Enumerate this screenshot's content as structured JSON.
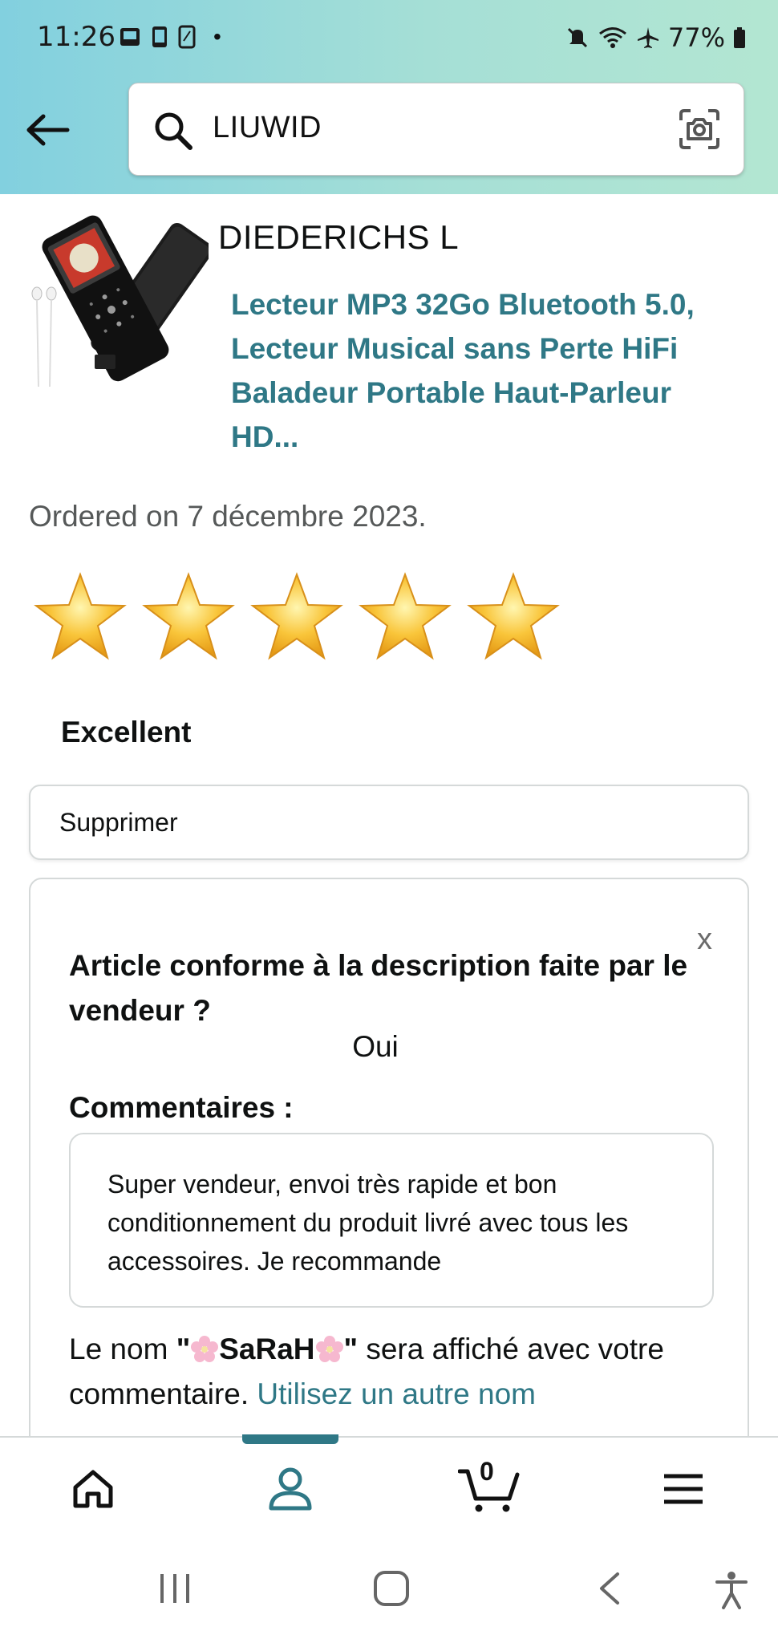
{
  "status_bar": {
    "time": "11:26",
    "dot": "•",
    "battery": "77%"
  },
  "search": {
    "value": "LIUWID"
  },
  "product": {
    "seller": "DIEDERICHS L",
    "title": "Lecteur MP3 32Go Bluetooth 5.0, Lecteur Musical sans Perte HiFi Baladeur Portable Haut-Parleur HD...",
    "ordered_on": "Ordered on 7 décembre 2023."
  },
  "rating": {
    "value": 5,
    "max": 5,
    "label": "Excellent"
  },
  "actions": {
    "delete_label": "Supprimer"
  },
  "feedback": {
    "close_label": "x",
    "question": "Article conforme à la description faite par le vendeur ?",
    "answer": "Oui",
    "comments_label": "Commentaires :",
    "comment": "Super vendeur, envoi très rapide et bon conditionnement du produit livré avec tous les accessoires. Je recommande",
    "name_prefix": "Le nom ",
    "quote_open": "\"",
    "nickname": "SaRaH",
    "quote_close": "\"",
    "name_suffix": " sera affiché avec votre commentaire. ",
    "change_name_link": "Utilisez un autre nom"
  },
  "bottom_nav": {
    "cart_count": "0",
    "active": "account"
  },
  "colors": {
    "accent": "#2f7886",
    "star": "#f7b731",
    "header_start": "#82d0df",
    "header_end": "#b3e6d2"
  },
  "icons": {
    "back": "back-arrow-icon",
    "search": "search-icon",
    "camera": "camera-icon",
    "home": "home-icon",
    "account": "account-icon",
    "cart": "cart-icon",
    "menu": "menu-icon"
  }
}
